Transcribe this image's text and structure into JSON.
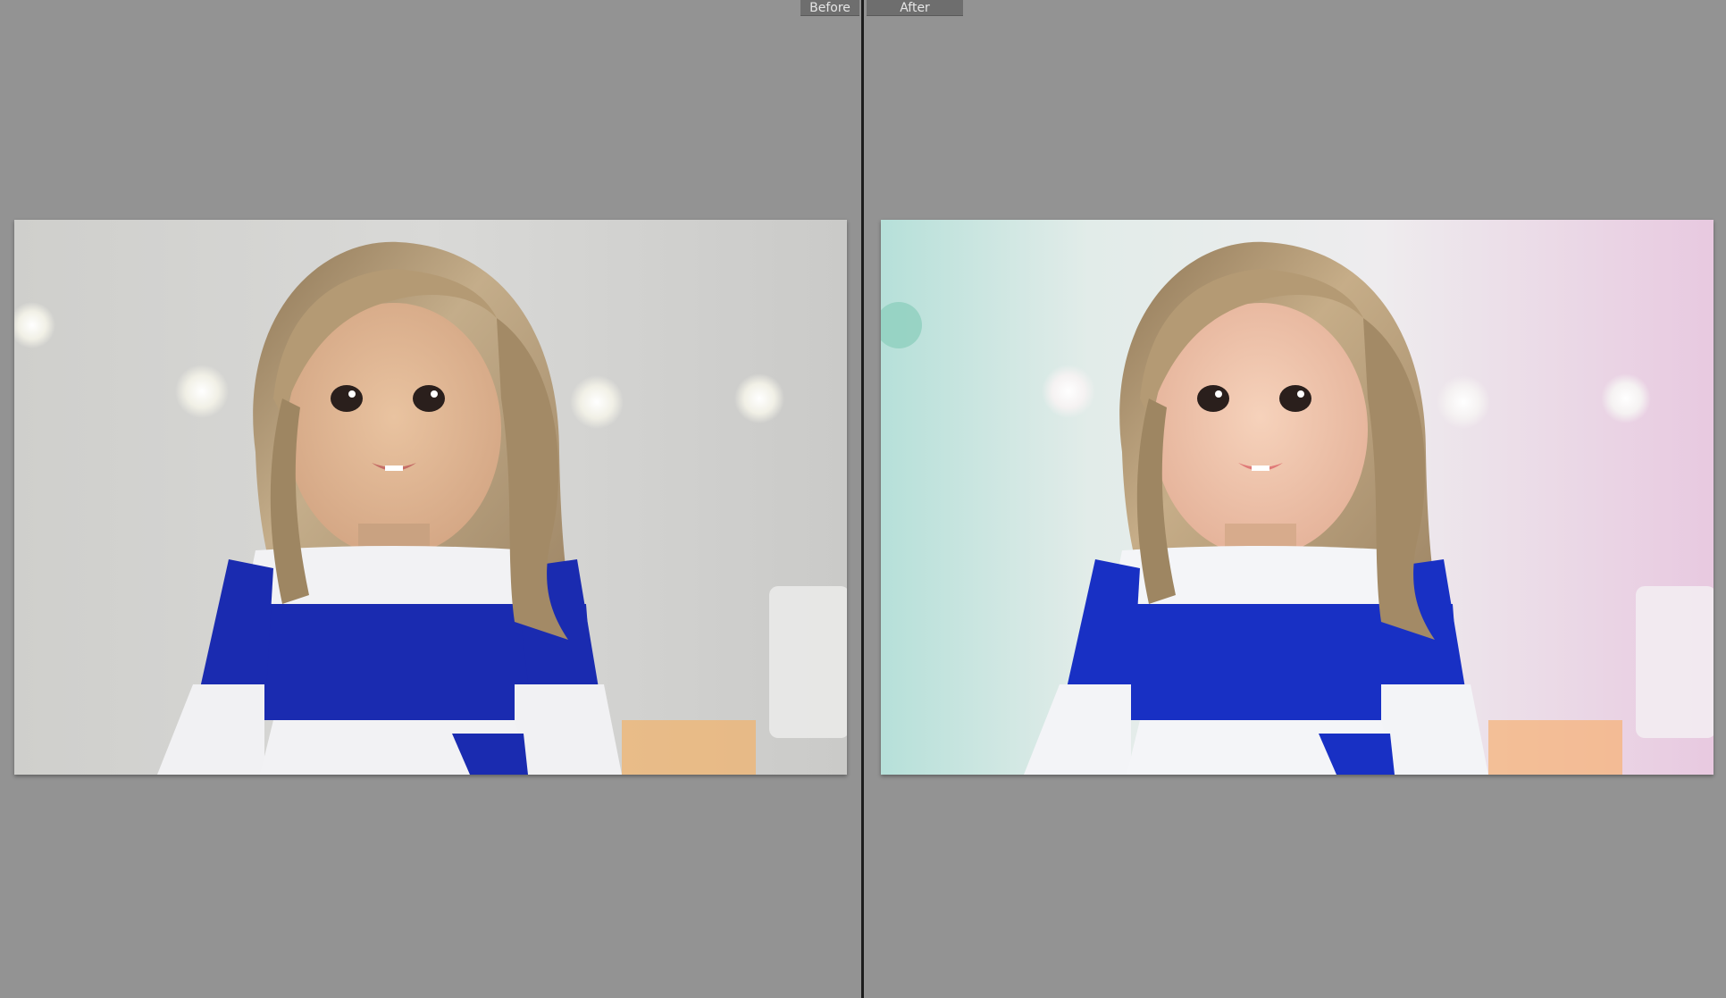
{
  "view": {
    "before_label": "Before",
    "after_label": "After"
  },
  "photos": {
    "before": {
      "subject": "doll-portrait",
      "tone": "neutral-gray"
    },
    "after": {
      "subject": "doll-portrait",
      "tone": "teal-to-pink-tint"
    }
  },
  "colors": {
    "background": "#939393",
    "divider": "#1d1d1d",
    "tab": "#6e6e6e",
    "dress_blue": "#1a2bb0",
    "hair": "#b79f7d"
  }
}
